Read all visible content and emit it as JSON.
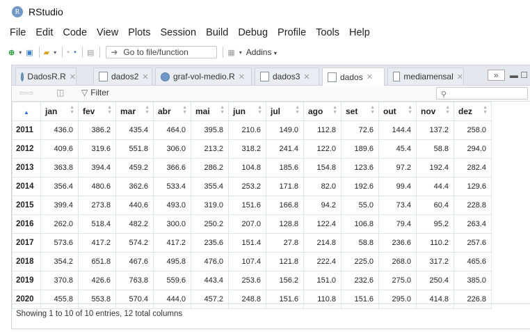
{
  "app": {
    "title": "RStudio",
    "icon_letter": "R"
  },
  "menu": [
    "File",
    "Edit",
    "Code",
    "View",
    "Plots",
    "Session",
    "Build",
    "Debug",
    "Profile",
    "Tools",
    "Help"
  ],
  "toolbar": {
    "goto_label": "Go to file/function",
    "addins_label": "Addins"
  },
  "tabs": [
    {
      "label": "DadosR.R",
      "icon": "r-script-icon",
      "active": false
    },
    {
      "label": "dados2",
      "icon": "table-icon",
      "active": false
    },
    {
      "label": "graf-vol-medio.R",
      "icon": "r-script-icon",
      "active": false
    },
    {
      "label": "dados3",
      "icon": "table-icon",
      "active": false
    },
    {
      "label": "dados",
      "icon": "table-icon",
      "active": true
    },
    {
      "label": "mediamensal",
      "icon": "table-icon",
      "active": false
    }
  ],
  "filter_label": "Filter",
  "table": {
    "columns": [
      "jan",
      "fev",
      "mar",
      "abr",
      "mai",
      "jun",
      "jul",
      "ago",
      "set",
      "out",
      "nov",
      "dez"
    ],
    "rows": [
      {
        "name": "2011",
        "values": [
          "436.0",
          "386.2",
          "435.4",
          "464.0",
          "395.8",
          "210.6",
          "149.0",
          "112.8",
          "72.6",
          "144.4",
          "137.2",
          "258.0"
        ]
      },
      {
        "name": "2012",
        "values": [
          "409.6",
          "319.6",
          "551.8",
          "306.0",
          "213.2",
          "318.2",
          "241.4",
          "122.0",
          "189.6",
          "45.4",
          "58.8",
          "294.0"
        ]
      },
      {
        "name": "2013",
        "values": [
          "363.8",
          "394.4",
          "459.2",
          "366.6",
          "286.2",
          "104.8",
          "185.6",
          "154.8",
          "123.6",
          "97.2",
          "192.4",
          "282.4"
        ]
      },
      {
        "name": "2014",
        "values": [
          "356.4",
          "480.6",
          "362.6",
          "533.4",
          "355.4",
          "253.2",
          "171.8",
          "82.0",
          "192.6",
          "99.4",
          "44.4",
          "129.6"
        ]
      },
      {
        "name": "2015",
        "values": [
          "399.4",
          "273.8",
          "440.6",
          "493.0",
          "319.0",
          "151.6",
          "166.8",
          "94.2",
          "55.0",
          "73.4",
          "60.4",
          "228.8"
        ]
      },
      {
        "name": "2016",
        "values": [
          "262.0",
          "518.4",
          "482.2",
          "300.0",
          "250.2",
          "207.0",
          "128.8",
          "122.4",
          "106.8",
          "79.4",
          "95.2",
          "263.4"
        ]
      },
      {
        "name": "2017",
        "values": [
          "573.6",
          "417.2",
          "574.2",
          "417.2",
          "235.6",
          "151.4",
          "27.8",
          "214.8",
          "58.8",
          "236.6",
          "110.2",
          "257.6"
        ]
      },
      {
        "name": "2018",
        "values": [
          "354.2",
          "651.8",
          "467.6",
          "495.8",
          "476.0",
          "107.4",
          "121.8",
          "222.4",
          "225.0",
          "268.0",
          "317.2",
          "465.6"
        ]
      },
      {
        "name": "2019",
        "values": [
          "370.8",
          "426.6",
          "763.8",
          "559.6",
          "443.4",
          "253.6",
          "156.2",
          "151.0",
          "232.6",
          "275.0",
          "250.4",
          "385.0"
        ]
      },
      {
        "name": "2020",
        "values": [
          "455.8",
          "553.8",
          "570.4",
          "444.0",
          "457.2",
          "248.8",
          "151.6",
          "110.8",
          "151.6",
          "295.0",
          "414.8",
          "226.8"
        ]
      }
    ]
  },
  "status_text": "Showing 1 to 10 of 10 entries, 12 total columns"
}
